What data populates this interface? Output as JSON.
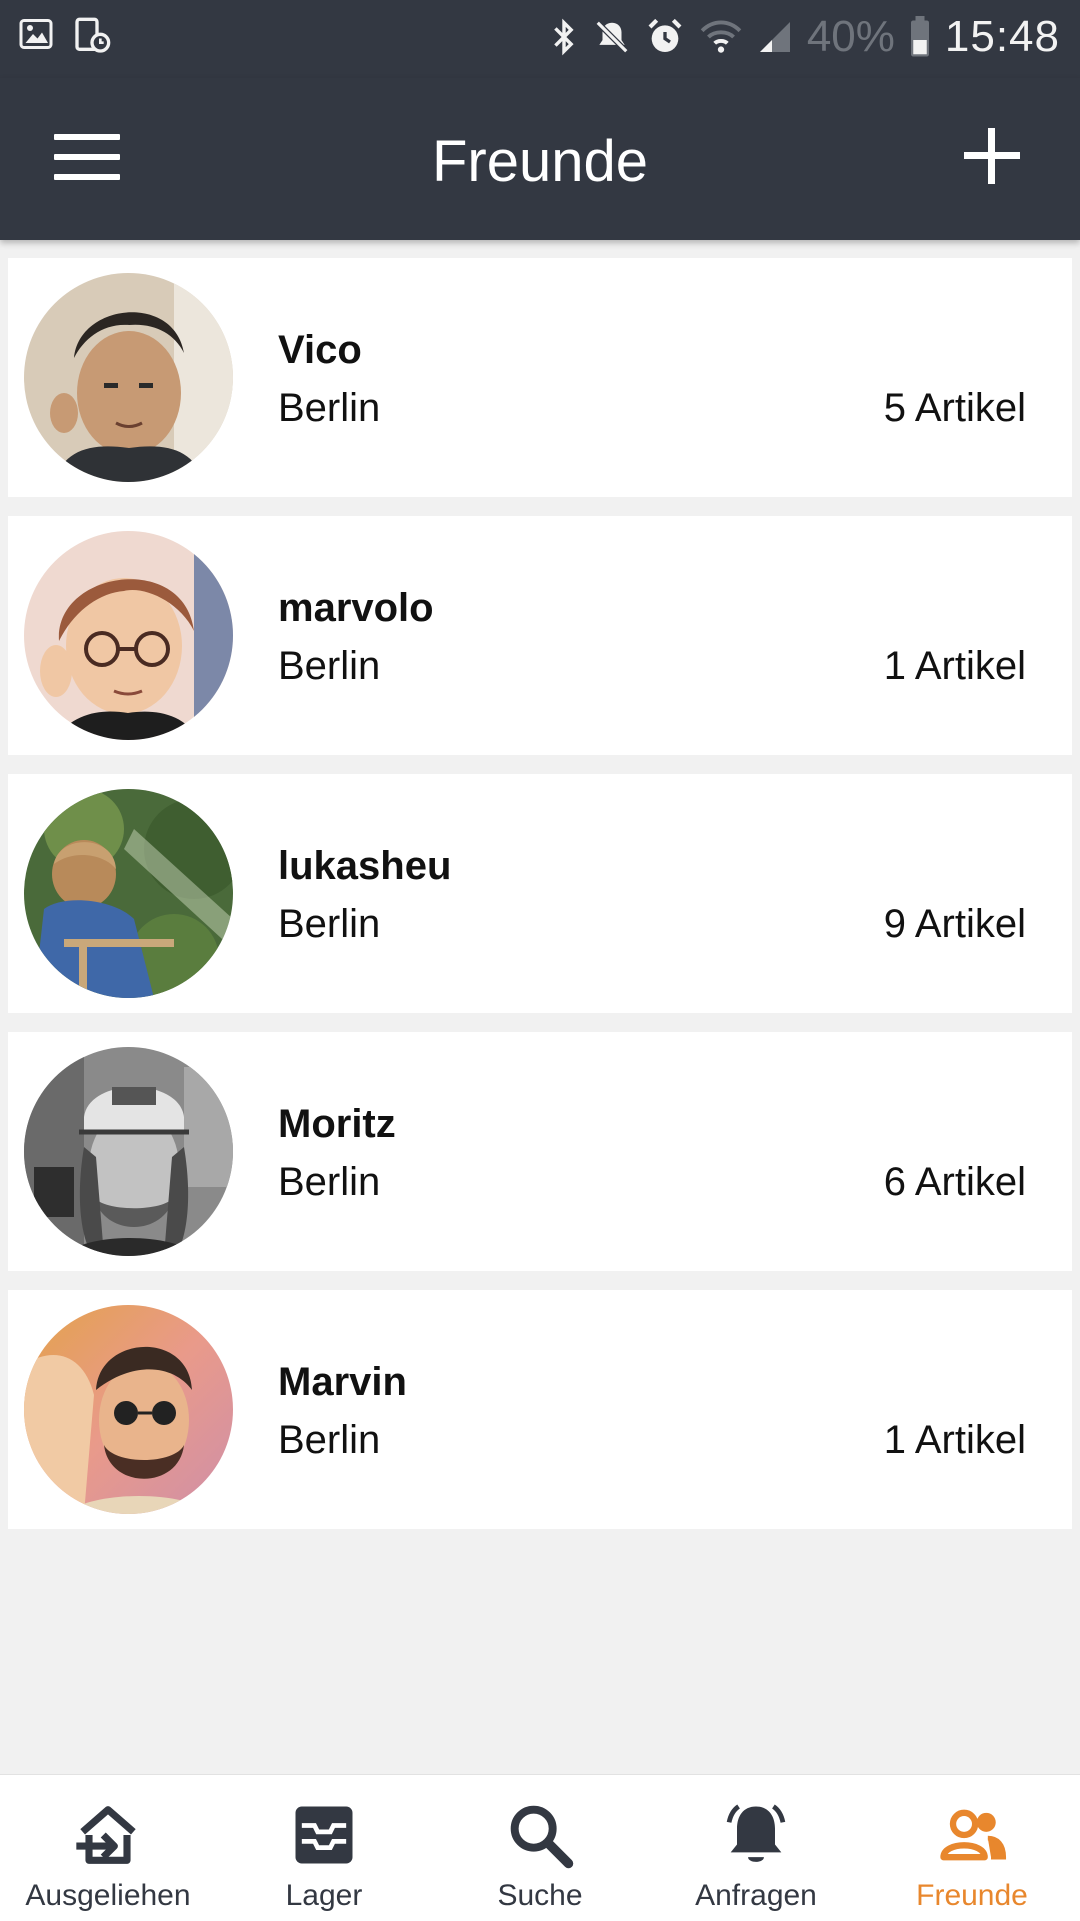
{
  "status_bar": {
    "battery": "40%",
    "time": "15:48",
    "icons": [
      "image-icon",
      "screenshot-icon",
      "bluetooth-icon",
      "mute-icon",
      "alarm-icon",
      "wifi-icon",
      "signal-icon",
      "battery-icon"
    ]
  },
  "app_bar": {
    "title": "Freunde",
    "menu_icon": "menu-icon",
    "add_icon": "plus-icon"
  },
  "friends": [
    {
      "name": "Vico",
      "city": "Berlin",
      "count": "5 Artikel"
    },
    {
      "name": "marvolo",
      "city": "Berlin",
      "count": "1 Artikel"
    },
    {
      "name": "lukasheu",
      "city": "Berlin",
      "count": "9 Artikel"
    },
    {
      "name": "Moritz",
      "city": "Berlin",
      "count": "6 Artikel"
    },
    {
      "name": "Marvin",
      "city": "Berlin",
      "count": "1 Artikel"
    }
  ],
  "bottom_nav": [
    {
      "label": "Ausgeliehen",
      "icon": "borrow-icon",
      "active": false
    },
    {
      "label": "Lager",
      "icon": "inventory-icon",
      "active": false
    },
    {
      "label": "Suche",
      "icon": "search-icon",
      "active": false
    },
    {
      "label": "Anfragen",
      "icon": "bell-icon",
      "active": false
    },
    {
      "label": "Freunde",
      "icon": "friends-icon",
      "active": true
    }
  ],
  "colors": {
    "app_bar": "#333842",
    "background": "#f1f1f1",
    "active_nav": "#e8872d",
    "inactive_nav": "#333842"
  }
}
